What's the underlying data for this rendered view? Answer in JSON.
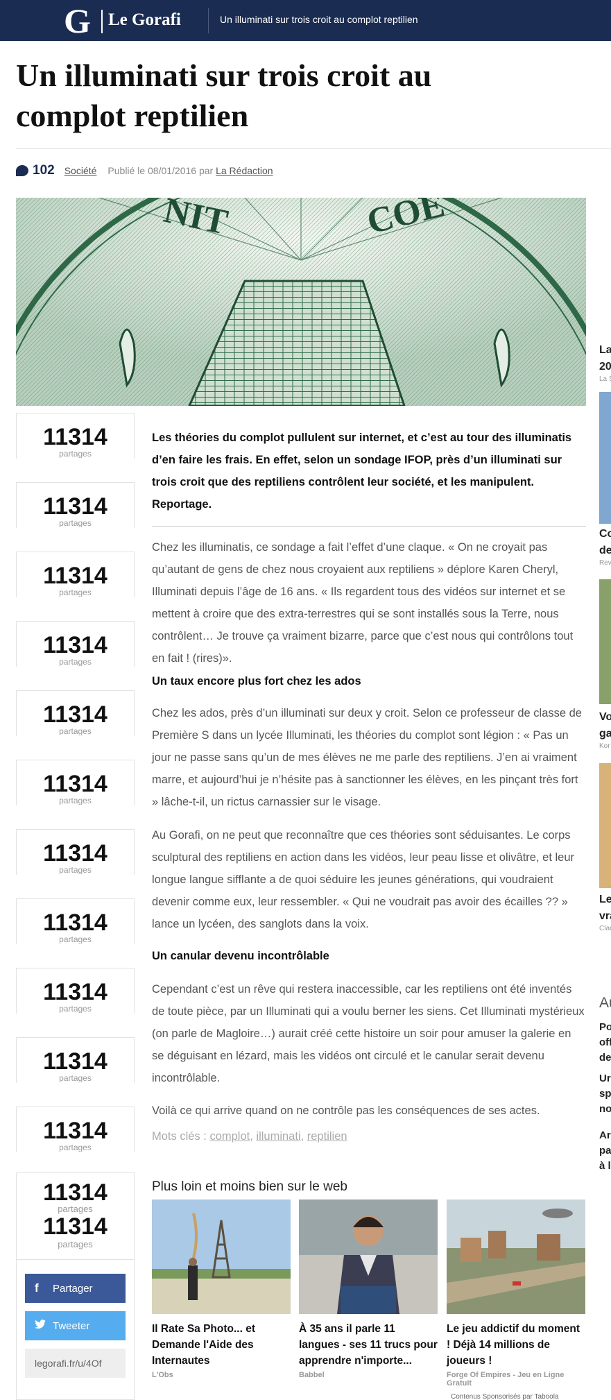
{
  "header": {
    "logo_letter": "G",
    "logo_text": "Le Gorafi",
    "title": "Un illuminati sur trois croit au complot reptilien"
  },
  "article": {
    "headline": "Un illuminati sur trois croit au complot reptilien",
    "comment_count": "102",
    "category": "Société",
    "published_prefix": "Publié le 08/01/2016 par",
    "author": "La Rédaction",
    "intro": "Les théories du complot pullulent sur internet, et c’est au tour des illuminatis d’en faire les frais. En effet, selon un sondage IFOP, près d’un illuminati sur trois croit que des reptiliens contrôlent leur société, et les manipulent. Reportage.",
    "paragraph_1": "Chez les illuminatis, ce sondage a fait l’effet d’une claque. « On ne croyait pas qu’autant de gens de chez nous croyaient aux reptiliens » déplore Karen Cheryl, Illuminati depuis l’âge de 16 ans. « Ils regardent tous des vidéos sur internet et se mettent à croire que des extra-terrestres qui se sont installés sous la Terre, nous contrôlent… Je trouve ça vraiment bizarre, parce que c’est nous qui contrôlons tout en fait ! (rires)».",
    "subhead_1": "Un taux encore plus fort chez les ados",
    "paragraph_2": "Chez les ados, près d’un illuminati sur deux y croit. Selon ce professeur de classe de Première S dans un lycée Illuminati, les théories du complot sont légion : « Pas un jour ne passe sans qu’un de mes élèves ne me parle des reptiliens. J’en ai vraiment marre, et aujourd’hui je n’hésite pas à sanctionner les élèves, en les pinçant très fort » lâche-t-il, un rictus carnassier sur le visage.",
    "paragraph_3": "Au Gorafi, on ne peut que reconnaître que ces théories sont séduisantes. Le corps sculptural des reptiliens en action dans les vidéos, leur peau lisse et olivâtre, et leur longue langue sifflante a de quoi séduire les jeunes générations, qui voudraient devenir comme eux, leur ressembler. « Qui ne voudrait pas avoir des écailles ?? » lance un lycéen, des sanglots dans la voix.",
    "subhead_2": "Un canular devenu incontrôlable",
    "paragraph_4": "Cependant c’est un rêve qui restera inaccessible, car les reptiliens ont été inventés de toute pièce, par un Illuminati qui a voulu berner les siens. Cet Illuminati mystérieux (on parle de Magloire…) aurait créé cette histoire un soir pour amuser la galerie en se déguisant en lézard, mais les vidéos ont circulé et le canular serait devenu incontrôlable.",
    "paragraph_5": "Voilà ce qui arrive quand on ne contrôle pas les conséquences de ses actes.",
    "keywords_label": "Mots clés :",
    "keywords": [
      "complot",
      "illuminati",
      "reptilien"
    ]
  },
  "share": {
    "count": "11314",
    "label": "partages",
    "facebook": "Partager",
    "twitter": "Tweeter",
    "short_url": "legorafi.fr/u/4Of"
  },
  "related": {
    "heading": "Plus loin et moins bien sur le web",
    "items": [
      {
        "title": "Il Rate Sa Photo... et Demande l'Aide des Internautes",
        "source": "L'Obs"
      },
      {
        "title": "À 35 ans il parle 11 langues - ses 11 trucs pour apprendre n'importe...",
        "source": "Babbel"
      },
      {
        "title": "Le jeu addictif du moment ! Déjà 14 millions de joueurs !",
        "source": "Forge Of Empires - Jeu en Ligne Gratuit"
      }
    ],
    "sponsor_label": "Contenus Sponsorisés par Taboola"
  },
  "sidebar": {
    "items": [
      {
        "t1": "La",
        "t2": "20",
        "s": "La S"
      },
      {
        "t1": "Co",
        "t2": "de",
        "s": "Rev"
      },
      {
        "t1": "Vo",
        "t2": "ga",
        "s": "Kor"
      },
      {
        "t1": "Le",
        "t2": "vra",
        "s": "Clar"
      }
    ],
    "heading": "Au",
    "links": [
      {
        "l1": "Po",
        "l2": "off",
        "l3": "de"
      },
      {
        "l1": "Ur",
        "l2": "sp",
        "l3": "no"
      },
      {
        "l1": "Ar",
        "l2": "pa",
        "l3": "à l"
      }
    ]
  }
}
